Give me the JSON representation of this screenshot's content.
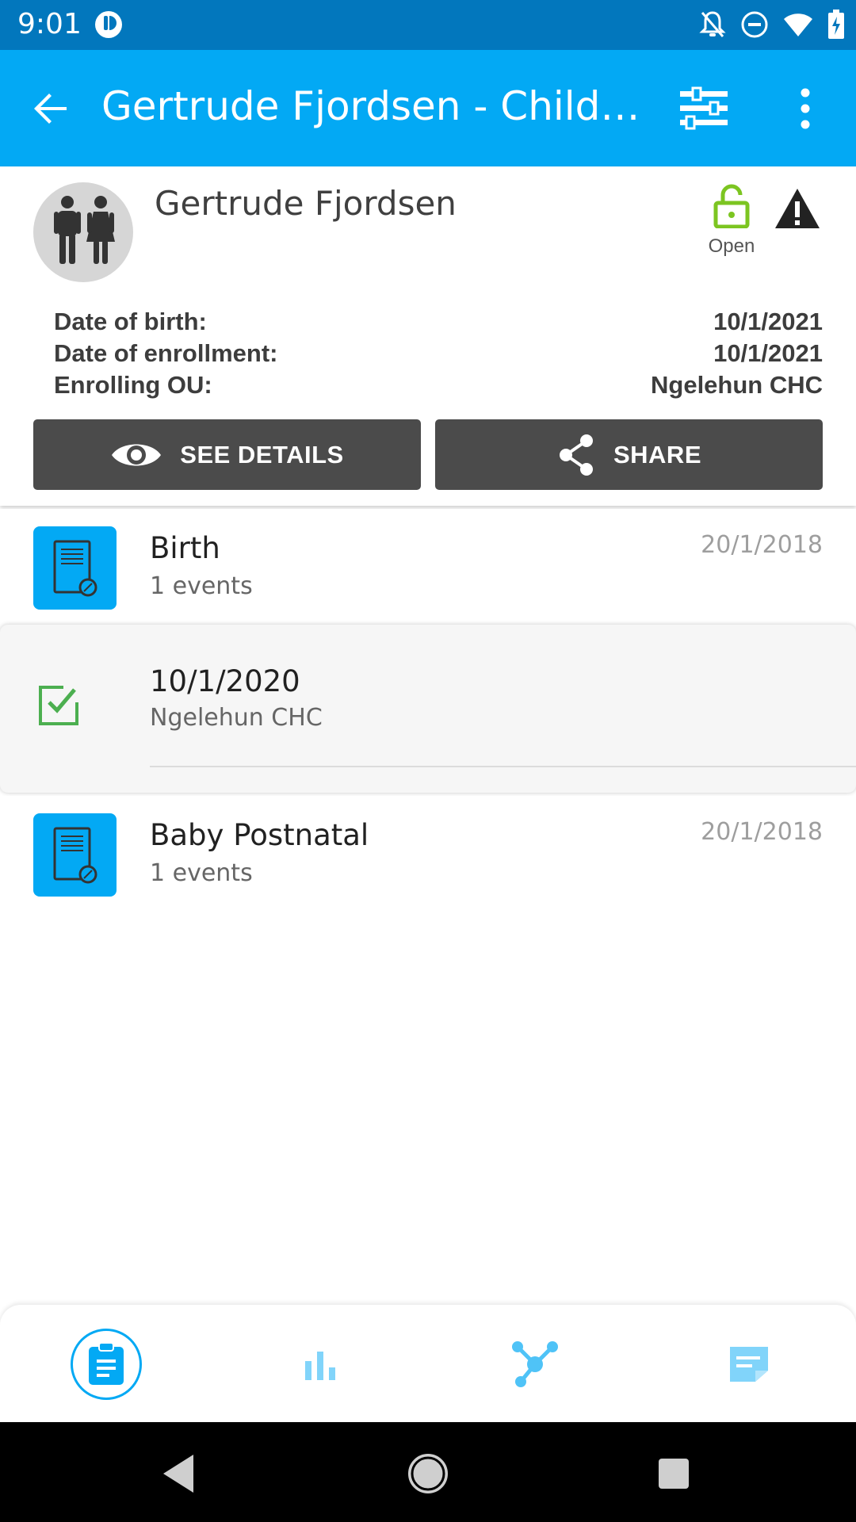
{
  "status_bar": {
    "time": "9:01",
    "icons": [
      "app-notification-icon",
      "notifications-off-icon",
      "do-not-disturb-icon",
      "wifi-icon",
      "battery-charging-icon"
    ]
  },
  "toolbar": {
    "title": "Gertrude Fjordsen - Child Programme",
    "icons": [
      "back-arrow-icon",
      "filter-icon",
      "more-vert-icon"
    ]
  },
  "profile": {
    "name": "Gertrude Fjordsen",
    "status_label": "Open",
    "rows": [
      {
        "label": "Date of birth:",
        "value": "10/1/2021"
      },
      {
        "label": "Date of enrollment:",
        "value": "10/1/2021"
      },
      {
        "label": "Enrolling OU:",
        "value": "Ngelehun CHC"
      }
    ],
    "see_details_label": "SEE DETAILS",
    "share_label": "SHARE"
  },
  "stages": [
    {
      "name": "Birth",
      "count": "1 events",
      "date": "20/1/2018"
    },
    {
      "name": "Baby Postnatal",
      "count": "1 events",
      "date": "20/1/2018"
    }
  ],
  "event": {
    "date": "10/1/2020",
    "org_unit": "Ngelehun CHC"
  },
  "bottom_nav": {
    "items": [
      "details-icon",
      "analytics-icon",
      "relationships-icon",
      "notes-icon"
    ],
    "active": "details-icon"
  },
  "colors": {
    "primary": "#03a9f4",
    "status_bar": "#0277bd",
    "button_dark": "#4b4b4b",
    "open_green": "#7cc521",
    "check_green": "#4caf50"
  }
}
